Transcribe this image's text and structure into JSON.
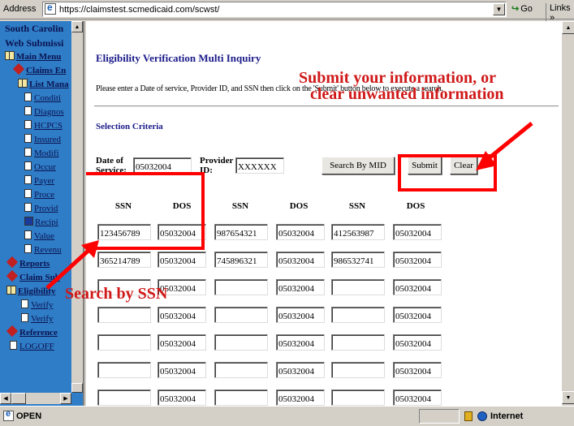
{
  "browser": {
    "address_label": "Address",
    "url": "https://claimstest.scmedicaid.com/scwst/",
    "go_label": "Go",
    "links_label": "Links »"
  },
  "sidebar": {
    "title_lines": [
      "South Carolin",
      "Web Submissi"
    ],
    "items": [
      {
        "label": "Main Menu",
        "icon": "book-icon"
      },
      {
        "label": "Claims En",
        "icon": "diamond-icon"
      },
      {
        "label": "List Mana",
        "icon": "book-icon"
      },
      {
        "label": "Conditi",
        "icon": "document-icon"
      },
      {
        "label": "Diagnos",
        "icon": "document-icon"
      },
      {
        "label": "HCPCS",
        "icon": "document-icon"
      },
      {
        "label": "Insured",
        "icon": "document-icon"
      },
      {
        "label": "Modifi",
        "icon": "document-icon"
      },
      {
        "label": "Occur",
        "icon": "document-icon"
      },
      {
        "label": "Payer",
        "icon": "document-icon"
      },
      {
        "label": "Proce",
        "icon": "document-icon"
      },
      {
        "label": "Provid",
        "icon": "document-icon"
      },
      {
        "label": "Recipi",
        "icon": "recipient-icon"
      },
      {
        "label": "Value",
        "icon": "document-icon"
      },
      {
        "label": "Revenu",
        "icon": "document-icon"
      },
      {
        "label": "Reports",
        "icon": "diamond-icon"
      },
      {
        "label": "Claim Sub",
        "icon": "diamond-icon"
      },
      {
        "label": "Eligibility",
        "icon": "book-icon"
      },
      {
        "label": "Verify",
        "icon": "document-icon"
      },
      {
        "label": "Verify",
        "icon": "document-icon"
      },
      {
        "label": "Reference",
        "icon": "diamond-icon"
      },
      {
        "label": "LOGOFF",
        "icon": "document-icon"
      }
    ]
  },
  "main": {
    "title": "Eligibility Verification Multi Inquiry",
    "instructions": "Please enter a Date of service, Provider ID, and SSN then click on the 'Submit' button below to execute a search.",
    "section_title": "Selection Criteria",
    "date_label_1": "Date of",
    "date_label_2": "Service:",
    "date_value": "05032004",
    "provider_label_1": "Provider",
    "provider_label_2": "ID:",
    "provider_value": "XXXXXX",
    "search_mid_label": "Search By MID",
    "submit_label": "Submit",
    "clear_label": "Clear",
    "columns": [
      "SSN",
      "DOS",
      "SSN",
      "DOS",
      "SSN",
      "DOS"
    ],
    "rows": [
      [
        "123456789",
        "05032004",
        "987654321",
        "05032004",
        "412563987",
        "05032004"
      ],
      [
        "365214789",
        "05032004",
        "745896321",
        "05032004",
        "986532741",
        "05032004"
      ],
      [
        "",
        "05032004",
        "",
        "05032004",
        "",
        "05032004"
      ],
      [
        "",
        "05032004",
        "",
        "05032004",
        "",
        "05032004"
      ],
      [
        "",
        "05032004",
        "",
        "05032004",
        "",
        "05032004"
      ],
      [
        "",
        "05032004",
        "",
        "05032004",
        "",
        "05032004"
      ],
      [
        "",
        "05032004",
        "",
        "05032004",
        "",
        "05032004"
      ]
    ]
  },
  "annotations": {
    "submit_callout_line1": "Submit your information, or",
    "submit_callout_line2": "clear unwanted information",
    "search_callout": "Search by SSN",
    "color": "#ff0000"
  },
  "status": {
    "text": "OPEN",
    "zone": "Internet"
  }
}
